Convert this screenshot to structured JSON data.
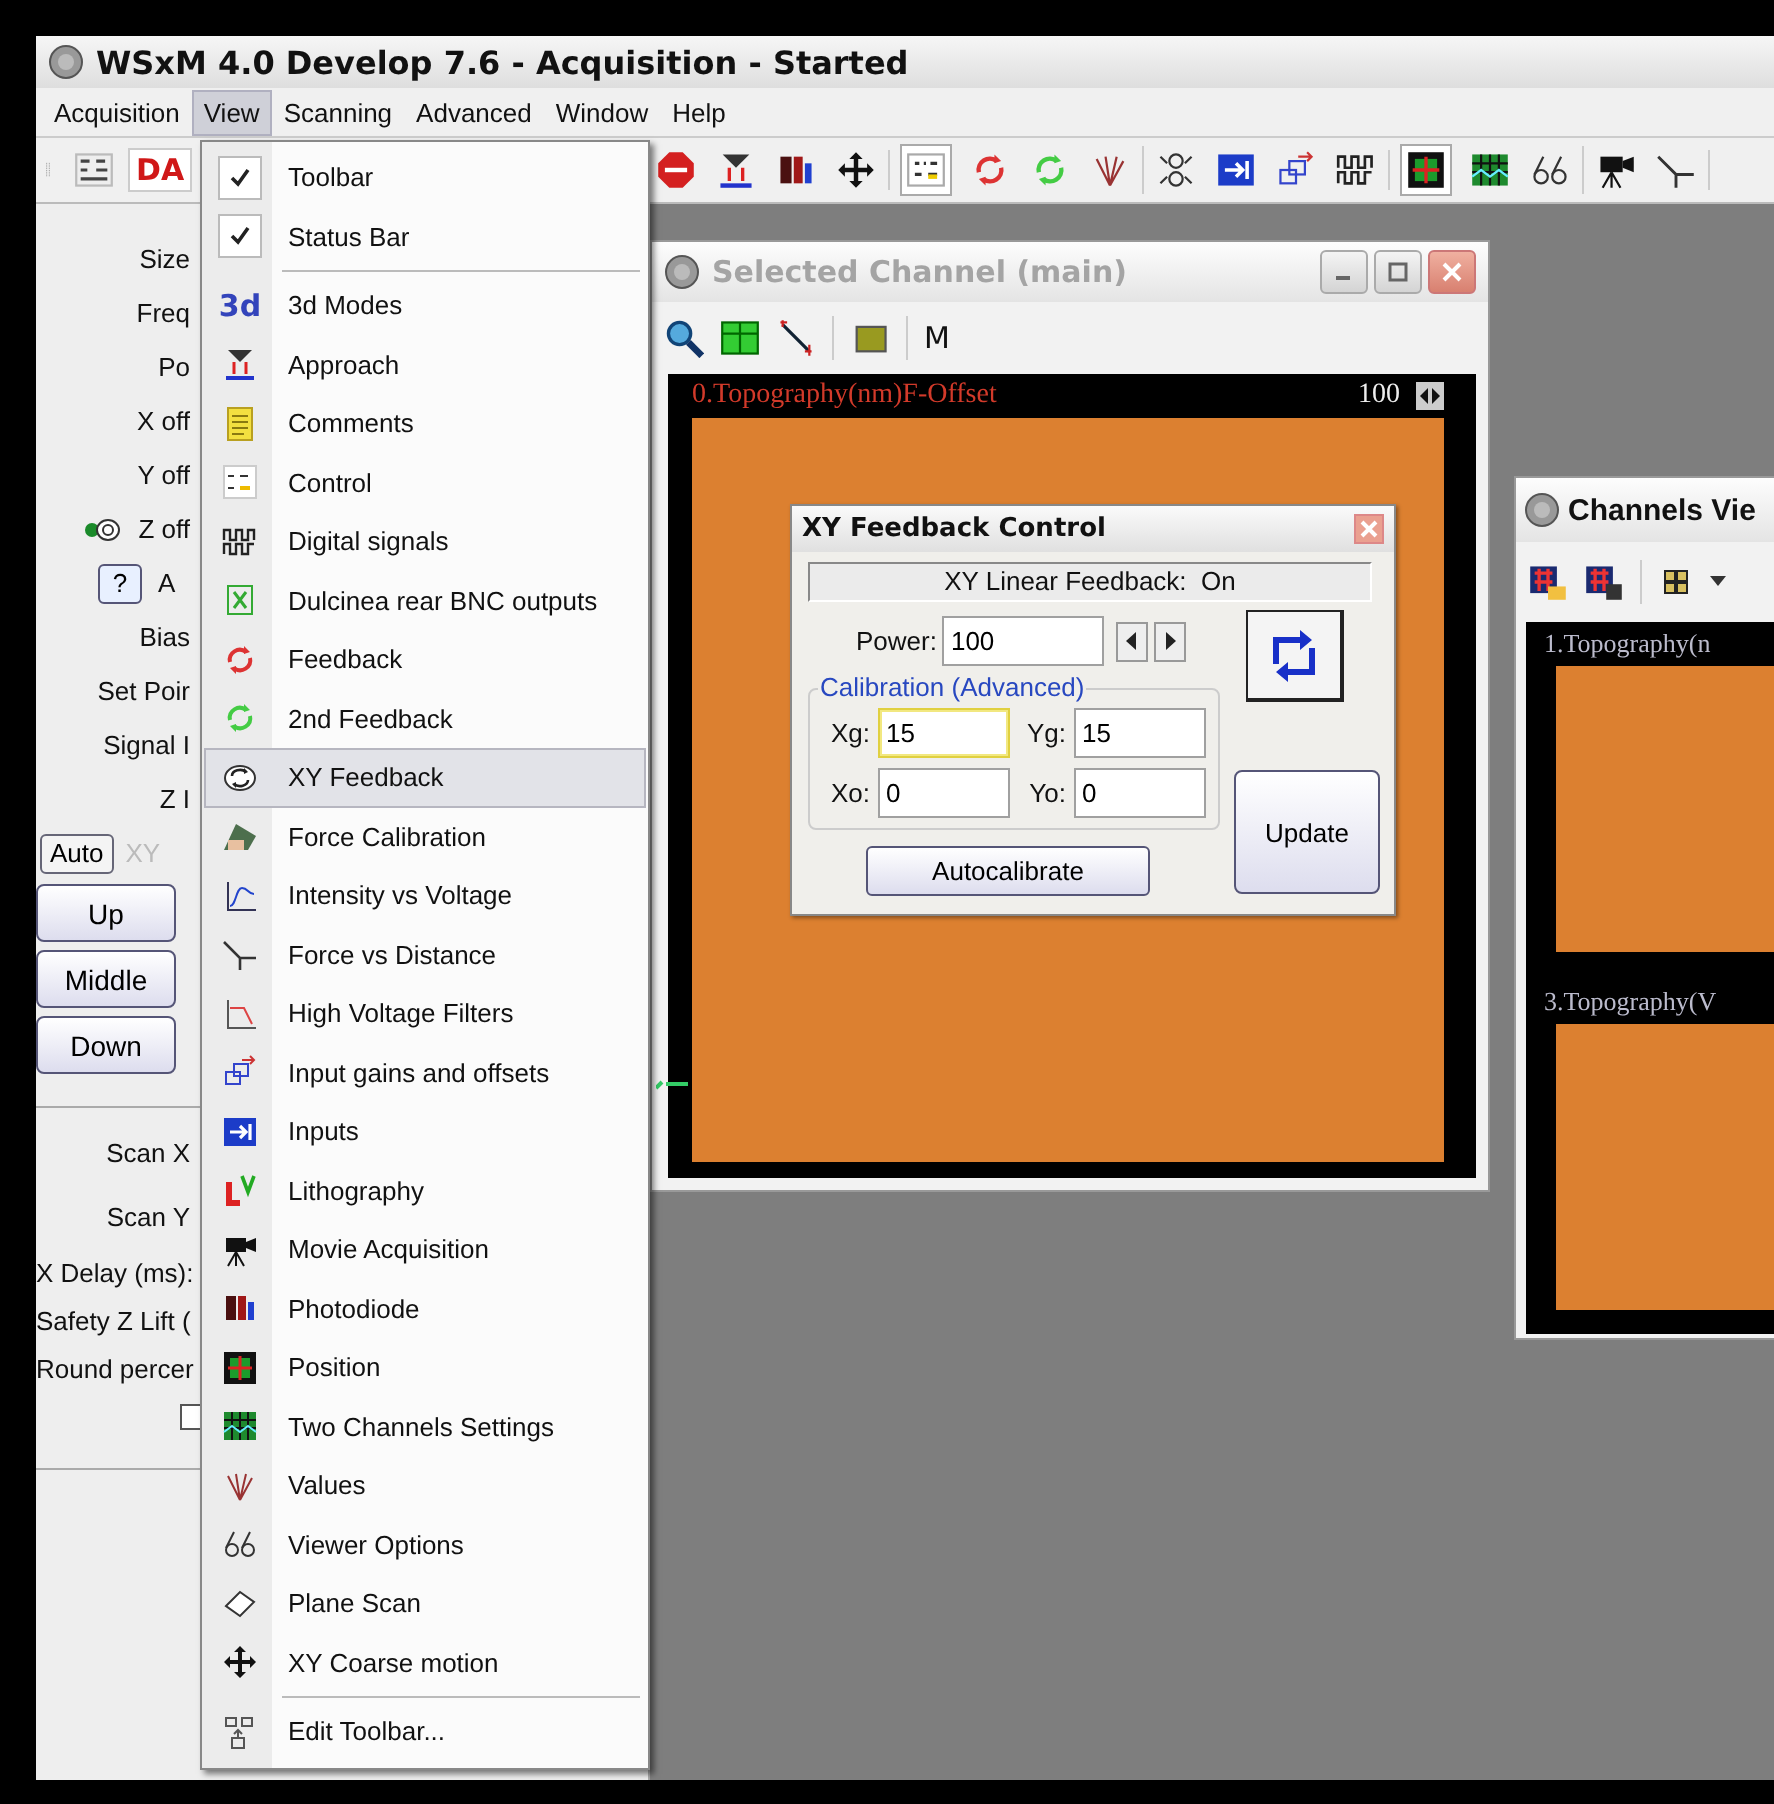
{
  "window": {
    "title": "WSxM 4.0 Develop 7.6 - Acquisition - Started"
  },
  "menubar": [
    {
      "label": "Acquisition",
      "selected": false
    },
    {
      "label": "View",
      "selected": true
    },
    {
      "label": "Scanning",
      "selected": false
    },
    {
      "label": "Advanced",
      "selected": false
    },
    {
      "label": "Window",
      "selected": false
    },
    {
      "label": "Help",
      "selected": false
    }
  ],
  "toolbar": {
    "label": "DA"
  },
  "left_panel": {
    "rows": [
      {
        "kind": "label",
        "text": "Size"
      },
      {
        "kind": "label",
        "text": "Freq"
      },
      {
        "kind": "label",
        "text": "Po"
      },
      {
        "kind": "label",
        "text": "X off"
      },
      {
        "kind": "label",
        "text": "Y off"
      },
      {
        "kind": "toggle",
        "text": "Z off"
      },
      {
        "kind": "help",
        "button": "?",
        "text": "A"
      },
      {
        "kind": "label",
        "text": "Bias"
      },
      {
        "kind": "label",
        "text": "Set Poir"
      },
      {
        "kind": "label",
        "text": "Signal I"
      },
      {
        "kind": "label",
        "text": "Z I"
      },
      {
        "kind": "auto",
        "button": "Auto",
        "text": "XY",
        "disabled": true
      },
      {
        "kind": "button",
        "button": "Up"
      },
      {
        "kind": "button",
        "button": "Middle"
      },
      {
        "kind": "button",
        "button": "Down"
      },
      {
        "kind": "separator"
      },
      {
        "kind": "field",
        "text": "Scan X"
      },
      {
        "kind": "field",
        "text": "Scan Y"
      },
      {
        "kind": "note",
        "text": "X Delay (ms):"
      },
      {
        "kind": "note",
        "text": "Safety Z Lift ("
      },
      {
        "kind": "note",
        "text": "Round percer"
      },
      {
        "kind": "checkbox",
        "checked": false
      },
      {
        "kind": "separator"
      }
    ]
  },
  "view_menu": {
    "items": [
      {
        "kind": "check",
        "label": "Toolbar",
        "checked": true,
        "selected": false
      },
      {
        "kind": "check",
        "label": "Status Bar",
        "checked": true,
        "selected": false
      },
      {
        "kind": "separator"
      },
      {
        "kind": "icon",
        "label": "3d Modes",
        "icon_text": "3d",
        "selected": false
      },
      {
        "kind": "icon",
        "label": "Approach",
        "selected": false
      },
      {
        "kind": "icon",
        "label": "Comments",
        "selected": false
      },
      {
        "kind": "icon",
        "label": "Control",
        "selected": false
      },
      {
        "kind": "icon",
        "label": "Digital signals",
        "selected": false
      },
      {
        "kind": "icon",
        "label": "Dulcinea rear BNC outputs",
        "selected": false
      },
      {
        "kind": "icon",
        "label": "Feedback",
        "selected": false
      },
      {
        "kind": "icon",
        "label": "2nd Feedback",
        "selected": false
      },
      {
        "kind": "icon",
        "label": "XY Feedback",
        "selected": true
      },
      {
        "kind": "icon",
        "label": "Force Calibration",
        "selected": false
      },
      {
        "kind": "icon",
        "label": "Intensity vs Voltage",
        "selected": false
      },
      {
        "kind": "icon",
        "label": "Force vs Distance",
        "selected": false
      },
      {
        "kind": "icon",
        "label": "High Voltage Filters",
        "selected": false
      },
      {
        "kind": "icon",
        "label": "Input gains and offsets",
        "selected": false
      },
      {
        "kind": "icon",
        "label": "Inputs",
        "selected": false
      },
      {
        "kind": "icon",
        "label": "Lithography",
        "selected": false
      },
      {
        "kind": "icon",
        "label": "Movie Acquisition",
        "selected": false
      },
      {
        "kind": "icon",
        "label": "Photodiode",
        "selected": false
      },
      {
        "kind": "icon",
        "label": "Position",
        "selected": false
      },
      {
        "kind": "icon",
        "label": "Two Channels Settings",
        "selected": false
      },
      {
        "kind": "icon",
        "label": "Values",
        "selected": false
      },
      {
        "kind": "icon",
        "label": "Viewer Options",
        "selected": false
      },
      {
        "kind": "icon",
        "label": "Plane Scan",
        "selected": false
      },
      {
        "kind": "icon",
        "label": "XY Coarse motion",
        "selected": false
      },
      {
        "kind": "separator"
      },
      {
        "kind": "icon",
        "label": "Edit Toolbar...",
        "selected": false
      }
    ]
  },
  "selected_channel": {
    "title": "Selected Channel (main)",
    "toolbar_text": "M",
    "channel_label": "0.Topography(nm)F-Offset",
    "value": "100"
  },
  "xy_feedback": {
    "title": "XY Feedback Control",
    "status": "XY Linear Feedback:  On",
    "power": {
      "label": "Power:",
      "value": "100"
    },
    "group": "Calibration (Advanced)",
    "fields": [
      {
        "label": "Xg:",
        "value": "15",
        "focused": true
      },
      {
        "label": "Yg:",
        "value": "15",
        "focused": false
      },
      {
        "label": "Xo:",
        "value": "0",
        "focused": false
      },
      {
        "label": "Yo:",
        "value": "0",
        "focused": false
      }
    ],
    "update": "Update",
    "autocalibrate": "Autocalibrate"
  },
  "channels_viewer": {
    "title": "Channels Vie",
    "channels": [
      {
        "label": "1.Topography(n"
      },
      {
        "label": "3.Topography(V"
      }
    ]
  }
}
